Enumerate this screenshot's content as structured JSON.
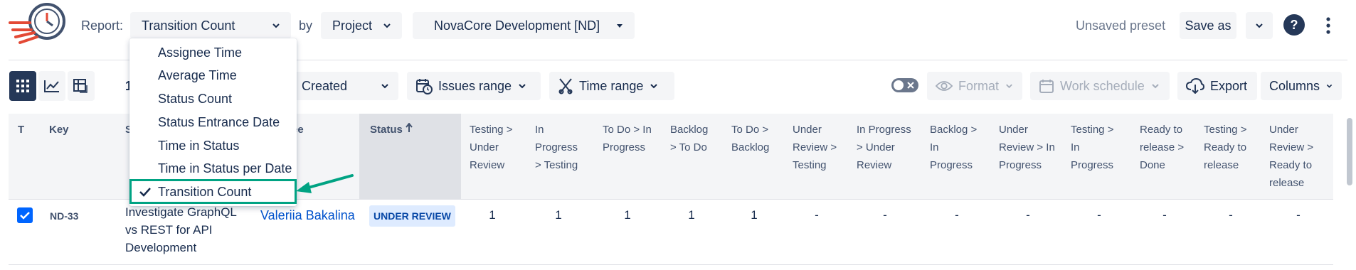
{
  "header": {
    "report_label": "Report:",
    "report_value": "Transition Count",
    "by_label": "by",
    "group_value": "Project",
    "project_value": "NovaCore Development [ND]",
    "preset_text": "Unsaved preset",
    "save_as_label": "Save as"
  },
  "menu": {
    "items": [
      "Assignee Time",
      "Average Time",
      "Status Count",
      "Status Entrance Date",
      "Time in Status",
      "Time in Status per Date",
      "Transition Count"
    ],
    "selected": "Transition Count"
  },
  "toolbar": {
    "count_fragment": "1",
    "date_field": "Created",
    "issues_range": "Issues range",
    "time_range": "Time range",
    "format": "Format",
    "work_schedule": "Work schedule",
    "export": "Export",
    "columns": "Columns"
  },
  "table": {
    "headers": {
      "t": "T",
      "key": "Key",
      "summary_fragment": "S",
      "assignee_fragment": "ee",
      "status": "Status"
    },
    "transition_headers": [
      [
        "Testing >",
        "Under",
        "Review"
      ],
      [
        "In",
        "Progress",
        "> Testing"
      ],
      [
        "To Do > In",
        "Progress"
      ],
      [
        "Backlog",
        "> To Do"
      ],
      [
        "To Do >",
        "Backlog"
      ],
      [
        "Under",
        "Review >",
        "Testing"
      ],
      [
        "In Progress",
        "> Under",
        "Review"
      ],
      [
        "Backlog >",
        "In",
        "Progress"
      ],
      [
        "Under",
        "Review > In",
        "Progress"
      ],
      [
        "Testing >",
        "In",
        "Progress"
      ],
      [
        "Ready to",
        "release >",
        "Done"
      ],
      [
        "Testing >",
        "Ready to",
        "release"
      ],
      [
        "Under",
        "Review >",
        "Ready to",
        "release"
      ]
    ],
    "rows": [
      {
        "key": "ND-33",
        "summary": [
          "Investigate GraphQL",
          "vs REST for API",
          "Development"
        ],
        "assignee": "Valeriia Bakalina",
        "status": "UNDER REVIEW",
        "values": [
          "1",
          "1",
          "1",
          "1",
          "1",
          "-",
          "-",
          "-",
          "-",
          "-",
          "-",
          "-",
          "-"
        ]
      }
    ]
  },
  "colors": {
    "accent": "#0065ff",
    "highlight": "#00a383",
    "link": "#0052cc",
    "logo_red": "#e34935"
  }
}
